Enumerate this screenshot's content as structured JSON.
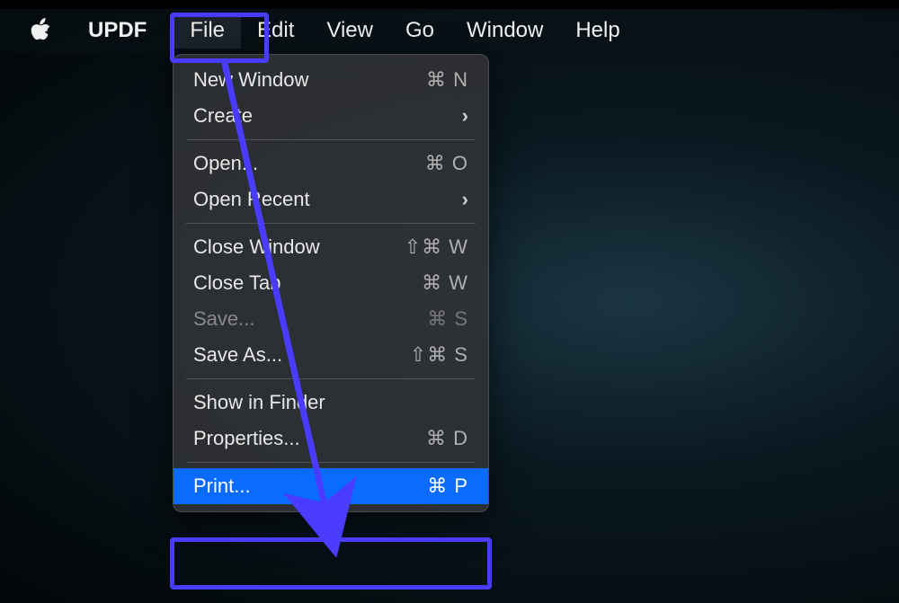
{
  "menubar": {
    "app_name": "UPDF",
    "items": [
      {
        "label": "File",
        "active": true
      },
      {
        "label": "Edit"
      },
      {
        "label": "View"
      },
      {
        "label": "Go"
      },
      {
        "label": "Window"
      },
      {
        "label": "Help"
      }
    ]
  },
  "dropdown": {
    "groups": [
      [
        {
          "label": "New Window",
          "shortcut": "⌘ N"
        },
        {
          "label": "Create",
          "submenu": true
        }
      ],
      [
        {
          "label": "Open...",
          "shortcut": "⌘ O"
        },
        {
          "label": "Open Recent",
          "submenu": true
        }
      ],
      [
        {
          "label": "Close Window",
          "shortcut": "⇧⌘ W"
        },
        {
          "label": "Close Tab",
          "shortcut": "⌘ W"
        },
        {
          "label": "Save...",
          "shortcut": "⌘ S",
          "disabled": true
        },
        {
          "label": "Save As...",
          "shortcut": "⇧⌘ S"
        }
      ],
      [
        {
          "label": "Show in Finder"
        },
        {
          "label": "Properties...",
          "shortcut": "⌘ D"
        }
      ],
      [
        {
          "label": "Print...",
          "shortcut": "⌘ P",
          "selected": true
        }
      ]
    ]
  }
}
